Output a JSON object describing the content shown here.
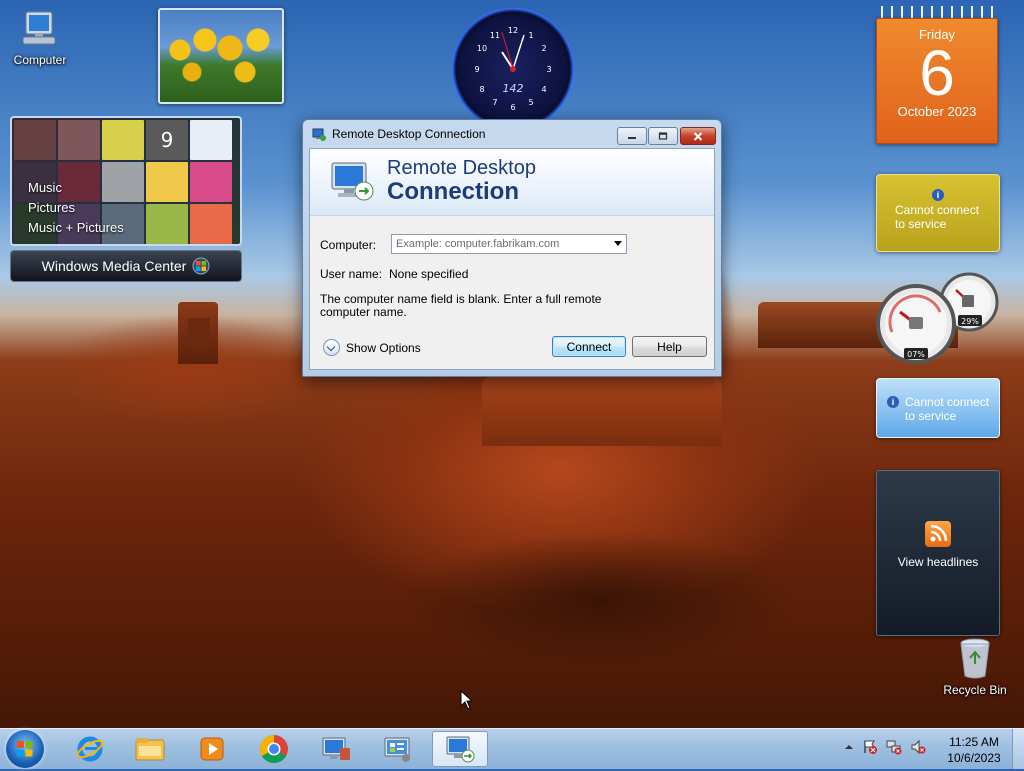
{
  "desktop": {
    "icons": [
      {
        "label": "Computer",
        "icon": "computer-icon"
      },
      {
        "label": "Recycle Bin",
        "icon": "recycle-bin-icon"
      }
    ]
  },
  "gadgets": {
    "clock": {
      "label": "142",
      "time": "11:25"
    },
    "calendar": {
      "day": "Friday",
      "date": "6",
      "month_year": "October 2023"
    },
    "weather": {
      "message": "Cannot connect to service",
      "line1": "Cannot connect",
      "line2": "to service"
    },
    "cpu_meter": {
      "cpu_percent": "07%",
      "memory_percent": "29%"
    },
    "currency": {
      "line1": "Cannot connect",
      "line2": "to service"
    },
    "feed_headlines": {
      "label": "View headlines"
    },
    "media_center": {
      "menu": [
        "Music",
        "Pictures",
        "Music + Pictures"
      ],
      "tile_clock": "9",
      "title": "Windows Media Center"
    }
  },
  "window": {
    "title": "Remote Desktop Connection",
    "banner_line1": "Remote Desktop",
    "banner_line2": "Connection",
    "computer_label": "Computer:",
    "computer_placeholder": "Example: computer.fabrikam.com",
    "computer_value": "",
    "username_label": "User name:",
    "username_value": "None specified",
    "message": "The computer name field is blank. Enter a full remote computer name.",
    "show_options": "Show Options",
    "connect_button": "Connect",
    "help_button": "Help"
  },
  "taskbar": {
    "pinned": [
      "start-button",
      "internet-explorer",
      "windows-explorer",
      "windows-media-player",
      "google-chrome",
      "remote-desktop-connection-pinned",
      "control-panel",
      "remote-desktop-connection-active"
    ],
    "clock_time": "11:25 AM",
    "clock_date": "10/6/2023"
  },
  "colors": {
    "calendar_orange": "#e8701f",
    "weather_yellow": "#c9b426",
    "currency_blue": "#6aaeea",
    "title_blue": "#1c3c7a",
    "taskbar_blue": "#a3c2e2"
  }
}
